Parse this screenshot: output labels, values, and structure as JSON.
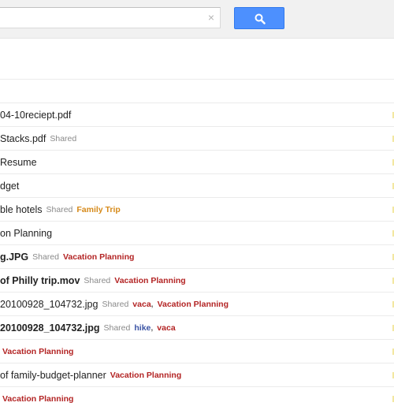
{
  "search": {
    "clear_glyph": "×"
  },
  "icons": {
    "search_button_icon": "search-icon",
    "clear_icon": "close-icon"
  },
  "colors": {
    "label_red": "#b32424",
    "label_orange": "#d68a1a",
    "label_blue": "#3a53a4",
    "search_blue": "#4d90fe"
  },
  "files": [
    {
      "name": "",
      "bold": false,
      "shared": "",
      "labels": []
    },
    {
      "name": "04-10reciept.pdf",
      "bold": false,
      "shared": "",
      "labels": []
    },
    {
      "name": "Stacks.pdf",
      "bold": false,
      "shared": "Shared",
      "labels": []
    },
    {
      "name": "Resume",
      "bold": false,
      "shared": "",
      "labels": []
    },
    {
      "name": "dget",
      "bold": false,
      "shared": "",
      "labels": []
    },
    {
      "name": "ble hotels",
      "bold": false,
      "shared": "Shared",
      "labels": [
        {
          "text": "Family Trip",
          "color": "orange"
        }
      ]
    },
    {
      "name": "on Planning",
      "bold": false,
      "shared": "",
      "labels": []
    },
    {
      "name": "g.JPG",
      "bold": true,
      "shared": "Shared",
      "labels": [
        {
          "text": "Vacation Planning",
          "color": "red"
        }
      ]
    },
    {
      "name": "of Philly trip.mov",
      "bold": true,
      "shared": "Shared",
      "labels": [
        {
          "text": "Vacation Planning",
          "color": "red"
        }
      ]
    },
    {
      "name": "20100928_104732.jpg",
      "bold": false,
      "shared": "Shared",
      "labels": [
        {
          "text": "vaca",
          "color": "red"
        },
        {
          "text": "Vacation Planning",
          "color": "red"
        }
      ]
    },
    {
      "name": "20100928_104732.jpg",
      "bold": true,
      "shared": "Shared",
      "labels": [
        {
          "text": "hike",
          "color": "blue"
        },
        {
          "text": "vaca",
          "color": "red"
        }
      ]
    },
    {
      "name": "",
      "bold": false,
      "shared": "",
      "labels": [
        {
          "text": "Vacation Planning",
          "color": "red"
        }
      ]
    },
    {
      "name": "of family-budget-planner",
      "bold": false,
      "shared": "",
      "labels": [
        {
          "text": "Vacation Planning",
          "color": "red"
        }
      ]
    },
    {
      "name": "",
      "bold": false,
      "shared": "",
      "labels": [
        {
          "text": "Vacation Planning",
          "color": "red"
        }
      ]
    }
  ]
}
